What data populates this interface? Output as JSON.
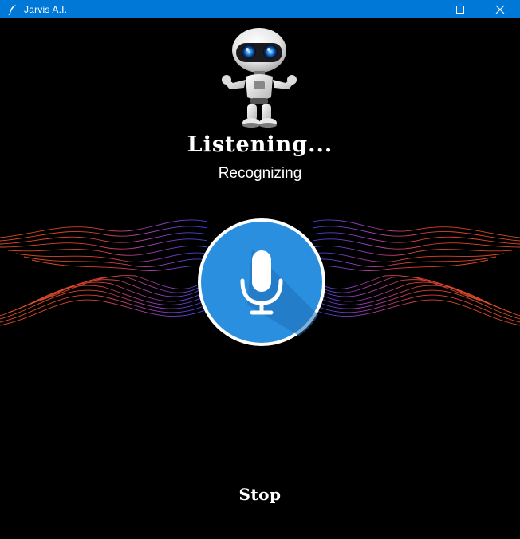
{
  "window": {
    "title": "Jarvis A.I.",
    "titlebar_color": "#0078d7",
    "icon": "feather-icon",
    "controls": [
      "minimize-icon",
      "maximize-icon",
      "close-icon"
    ]
  },
  "assistant": {
    "avatar": "robot-icon",
    "status": "Listening...",
    "substatus": "Recognizing",
    "mic_icon": "microphone-icon",
    "mic_color": "#2b8fdf"
  },
  "controls": {
    "stop_label": "Stop"
  }
}
